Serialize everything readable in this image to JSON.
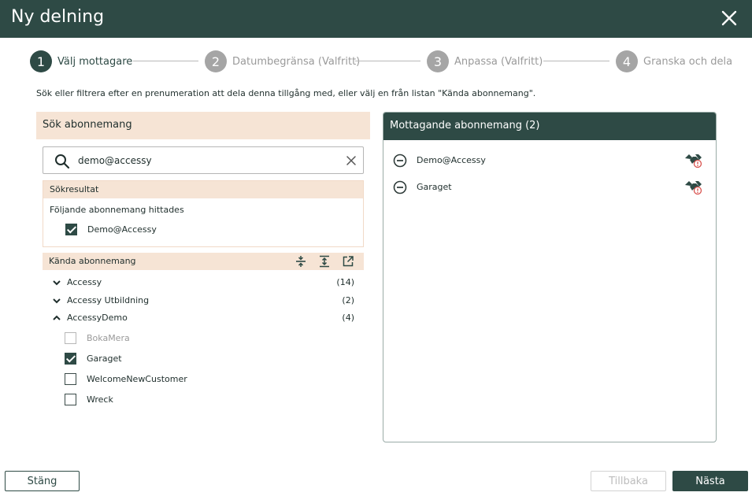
{
  "dialog": {
    "title": "Ny delning"
  },
  "steps": [
    {
      "num": "1",
      "label": "Välj mottagare"
    },
    {
      "num": "2",
      "label": "Datumbegränsa (Valfritt)"
    },
    {
      "num": "3",
      "label": "Anpassa (Valfritt)"
    },
    {
      "num": "4",
      "label": "Granska och dela"
    }
  ],
  "instruction": "Sök eller filtrera efter en prenumeration att dela denna tillgång med, eller välj en från listan \"Kända abonnemang\".",
  "search_panel": {
    "header": "Sök abonnemang",
    "search_value": "demo@accessy",
    "results_header": "Sökresultat",
    "results_found_text": "Följande abonnemang hittades",
    "results": [
      {
        "label": "Demo@Accessy",
        "checked": true
      }
    ]
  },
  "known": {
    "header": "Kända abonnemang",
    "groups": [
      {
        "name": "Accessy",
        "count": "(14)",
        "expanded": false
      },
      {
        "name": "Accessy Utbildning",
        "count": "(2)",
        "expanded": false
      },
      {
        "name": "AccessyDemo",
        "count": "(4)",
        "expanded": true
      }
    ],
    "items": [
      {
        "label": "BokaMera",
        "checked": false,
        "disabled": true
      },
      {
        "label": "Garaget",
        "checked": true,
        "disabled": false
      },
      {
        "label": "WelcomeNewCustomer",
        "checked": false,
        "disabled": false
      },
      {
        "label": "Wreck",
        "checked": false,
        "disabled": false
      }
    ]
  },
  "recipients_panel": {
    "header": "Mottagande abonnemang (2)",
    "recipients": [
      {
        "name": "Demo@Accessy"
      },
      {
        "name": "Garaget"
      }
    ]
  },
  "footer": {
    "close_label": "Stäng",
    "back_label": "Tillbaka",
    "next_label": "Nästa"
  },
  "colors": {
    "primary": "#2e4a45",
    "header_tint": "#f6e4d5",
    "inactive_step": "#a5a5a5",
    "alert_red": "#d9534f"
  }
}
